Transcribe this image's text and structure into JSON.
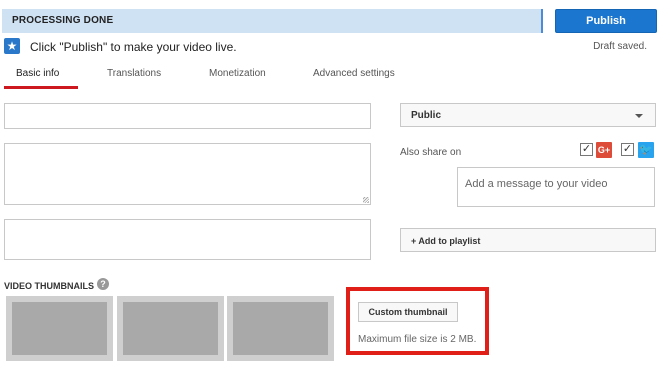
{
  "status": {
    "text": "PROCESSING DONE"
  },
  "publish": {
    "label": "Publish"
  },
  "hint": {
    "text": "Click \"Publish\" to make your video live.",
    "icon": "star-icon"
  },
  "draft_status": "Draft saved.",
  "tabs": [
    {
      "label": "Basic info",
      "active": true
    },
    {
      "label": "Translations",
      "active": false
    },
    {
      "label": "Monetization",
      "active": false
    },
    {
      "label": "Advanced settings",
      "active": false
    }
  ],
  "fields": {
    "title": {
      "value": "",
      "placeholder": ""
    },
    "description": {
      "value": "",
      "placeholder": ""
    },
    "tags": {
      "value": "",
      "placeholder": ""
    }
  },
  "privacy": {
    "selected": "Public"
  },
  "share": {
    "label": "Also share on",
    "google_plus": {
      "icon": "google-plus-icon",
      "glyph": "G+",
      "checked": true,
      "color": "#dd4b39"
    },
    "twitter": {
      "icon": "twitter-icon",
      "checked": true,
      "color": "#2aa3ef"
    },
    "message_placeholder": "Add a message to your video"
  },
  "playlist": {
    "label": "+ Add to playlist"
  },
  "thumbnails": {
    "heading": "VIDEO THUMBNAILS",
    "help_glyph": "?",
    "custom_button": "Custom thumbnail",
    "max_size": "Maximum file size is 2 MB."
  },
  "colors": {
    "status_bg": "#cfe2f3",
    "publish_bg": "#1b76cf",
    "active_tab": "#cc181e",
    "highlight_box": "#e01f19"
  }
}
